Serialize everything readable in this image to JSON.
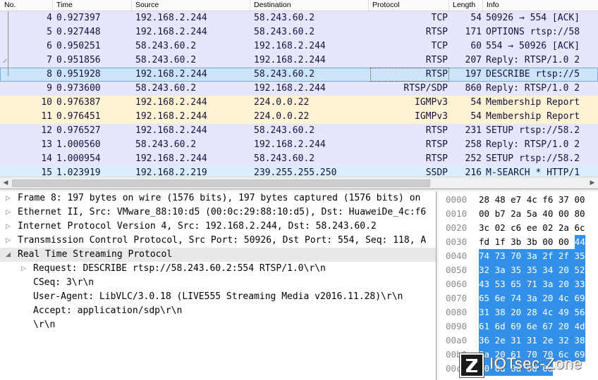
{
  "packet_list": {
    "columns": {
      "no": "No.",
      "time": "Time",
      "source": "Source",
      "destination": "Destination",
      "protocol": "Protocol",
      "length": "Length",
      "info": "Info"
    },
    "rows": [
      {
        "no": "4",
        "time": "0.927397",
        "source": "192.168.2.244",
        "destination": "58.243.60.2",
        "protocol": "TCP",
        "length": "54",
        "info": "50926 → 554 [ACK]",
        "bg": "#e7e6ff"
      },
      {
        "no": "5",
        "time": "0.927448",
        "source": "192.168.2.244",
        "destination": "58.243.60.2",
        "protocol": "RTSP",
        "length": "171",
        "info": "OPTIONS rtsp://58",
        "bg": "#e7e6ff"
      },
      {
        "no": "6",
        "time": "0.950251",
        "source": "58.243.60.2",
        "destination": "192.168.2.244",
        "protocol": "TCP",
        "length": "60",
        "info": "554 → 50926 [ACK]",
        "bg": "#e7e6ff"
      },
      {
        "no": "7",
        "time": "0.951856",
        "source": "58.243.60.2",
        "destination": "192.168.2.244",
        "protocol": "RTSP",
        "length": "207",
        "info": "Reply: RTSP/1.0 2",
        "bg": "#e7e6ff"
      },
      {
        "no": "8",
        "time": "0.951928",
        "source": "192.168.2.244",
        "destination": "58.243.60.2",
        "protocol": "RTSP",
        "length": "197",
        "info": "DESCRIBE rtsp://5",
        "bg": "#cce4f7",
        "selected": true
      },
      {
        "no": "9",
        "time": "0.973600",
        "source": "58.243.60.2",
        "destination": "192.168.2.244",
        "protocol": "RTSP/SDP",
        "length": "860",
        "info": "Reply: RTSP/1.0 2",
        "bg": "#e7e6ff"
      },
      {
        "no": "10",
        "time": "0.976387",
        "source": "192.168.2.244",
        "destination": "224.0.0.22",
        "protocol": "IGMPv3",
        "length": "54",
        "info": "Membership Report",
        "bg": "#fff3d6"
      },
      {
        "no": "11",
        "time": "0.976451",
        "source": "192.168.2.244",
        "destination": "224.0.0.22",
        "protocol": "IGMPv3",
        "length": "54",
        "info": "Membership Report",
        "bg": "#fff3d6"
      },
      {
        "no": "12",
        "time": "0.976527",
        "source": "192.168.2.244",
        "destination": "58.243.60.2",
        "protocol": "RTSP",
        "length": "231",
        "info": "SETUP rtsp://58.2",
        "bg": "#e7e6ff"
      },
      {
        "no": "13",
        "time": "1.000560",
        "source": "58.243.60.2",
        "destination": "192.168.2.244",
        "protocol": "RTSP",
        "length": "258",
        "info": "Reply: RTSP/1.0 2",
        "bg": "#e7e6ff"
      },
      {
        "no": "14",
        "time": "1.000954",
        "source": "192.168.2.244",
        "destination": "58.243.60.2",
        "protocol": "RTSP",
        "length": "252",
        "info": "SETUP rtsp://58.2",
        "bg": "#e7e6ff"
      },
      {
        "no": "15",
        "time": "1.023919",
        "source": "192.168.2.219",
        "destination": "239.255.255.250",
        "protocol": "SSDP",
        "length": "216",
        "info": "M-SEARCH * HTTP/1",
        "bg": "#daeeff"
      }
    ]
  },
  "details": {
    "lines": [
      {
        "text": "Frame 8: 197 bytes on wire (1576 bits), 197 bytes captured (1576 bits) on",
        "arrow": "collapsed",
        "indent": 0
      },
      {
        "text": "Ethernet II, Src: VMware_88:10:d5 (00:0c:29:88:10:d5), Dst: HuaweiDe_4c:f6",
        "arrow": "collapsed",
        "indent": 0
      },
      {
        "text": "Internet Protocol Version 4, Src: 192.168.2.244, Dst: 58.243.60.2",
        "arrow": "collapsed",
        "indent": 0
      },
      {
        "text": "Transmission Control Protocol, Src Port: 50926, Dst Port: 554, Seq: 118, A",
        "arrow": "collapsed",
        "indent": 0
      },
      {
        "text": "Real Time Streaming Protocol",
        "arrow": "expanded",
        "indent": 0,
        "selected": true
      },
      {
        "text": "Request: DESCRIBE rtsp://58.243.60.2:554 RTSP/1.0\\r\\n",
        "arrow": "collapsed",
        "indent": 1
      },
      {
        "text": "CSeq: 3\\r\\n",
        "arrow": "none",
        "indent": 1
      },
      {
        "text": "User-Agent: LibVLC/3.0.18 (LIVE555 Streaming Media v2016.11.28)\\r\\n",
        "arrow": "none",
        "indent": 1
      },
      {
        "text": "Accept: application/sdp\\r\\n",
        "arrow": "none",
        "indent": 1
      },
      {
        "text": "\\r\\n",
        "arrow": "none",
        "indent": 1
      }
    ]
  },
  "bytes": {
    "rows": [
      {
        "offset": "0000",
        "hex": "28 48 e7 4c f6 37 00",
        "hl": ""
      },
      {
        "offset": "0010",
        "hex": "00 b7 2a 5a 40 00 80",
        "hl": ""
      },
      {
        "offset": "0020",
        "hex": "3c 02 c6 ee 02 2a 6c",
        "hl": ""
      },
      {
        "offset": "0030",
        "hex": "fd 1f 3b 3b 00 00 ",
        "hl": "44"
      },
      {
        "offset": "0040",
        "hex": "",
        "hl": "74 73 70 3a 2f 2f 35"
      },
      {
        "offset": "0050",
        "hex": "",
        "hl": "32 3a 35 35 34 20 52"
      },
      {
        "offset": "0060",
        "hex": "",
        "hl": "43 53 65 71 3a 20 33"
      },
      {
        "offset": "0070",
        "hex": "",
        "hl": "65 6e 74 3a 20 4c 69"
      },
      {
        "offset": "0080",
        "hex": "",
        "hl": "31 38 20 28 4c 49 56"
      },
      {
        "offset": "0090",
        "hex": "",
        "hl": "61 6d 69 6e 67 20 4d"
      },
      {
        "offset": "00a0",
        "hex": "",
        "hl": "36 2e 31 31 2e 32 38"
      },
      {
        "offset": "00b0",
        "hex": "",
        "hl": "3a 20 61 70 70 6c 69"
      },
      {
        "offset": "00c0",
        "hex": "",
        "hl": "70 0d 0a 0d 0a"
      }
    ]
  },
  "watermark": {
    "text": "IOTsec-Zone"
  },
  "colors": {
    "selected_row": "#cce4f7",
    "tcp_rtsp_row": "#e7e6ff",
    "igmp_row": "#fff3d6",
    "ssdp_row": "#daeeff",
    "byte_highlight": "#3390e8"
  }
}
